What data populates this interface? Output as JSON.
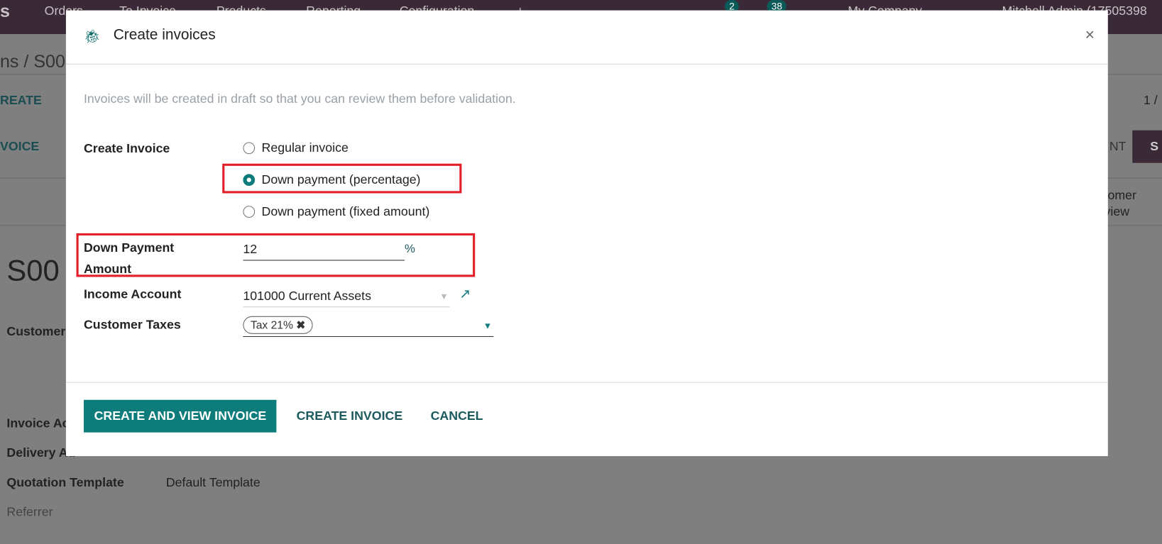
{
  "topbar": {
    "app": "s",
    "menu": [
      "Orders",
      "To Invoice",
      "Products",
      "Reporting",
      "Configuration"
    ],
    "plus": "+",
    "messages_count": "2",
    "activities_count": "38",
    "company": "My Company",
    "user": "Mitchell Admin (17505398"
  },
  "background": {
    "breadcrumb": "ns / S00",
    "create": "REATE",
    "pager": "1 /",
    "invoice_tab": "VOICE",
    "status_left": "NT",
    "status_right": "S",
    "customer_preview": [
      "tomer",
      "view"
    ],
    "record": "S00",
    "fields": [
      "Customer",
      "Invoice Ac",
      "Delivery Ad",
      "Quotation Template",
      "Referrer"
    ],
    "quotation_template_value": "Default Template"
  },
  "modal": {
    "title": "Create invoices",
    "icon": "bug-icon",
    "close": "×",
    "hint": "Invoices will be created in draft so that you can review them before validation.",
    "create_invoice_label": "Create Invoice",
    "options": [
      {
        "label": "Regular invoice",
        "selected": false
      },
      {
        "label": "Down payment (percentage)",
        "selected": true
      },
      {
        "label": "Down payment (fixed amount)",
        "selected": false
      }
    ],
    "down_payment_label": "Down Payment Amount",
    "down_payment_value": "12",
    "down_payment_unit": "%",
    "income_account_label": "Income Account",
    "income_account_value": "101000 Current Assets",
    "customer_taxes_label": "Customer Taxes",
    "tax_tag": "Tax 21%",
    "buttons": {
      "create_view": "CREATE AND VIEW INVOICE",
      "create": "CREATE INVOICE",
      "cancel": "CANCEL"
    }
  },
  "colors": {
    "primary": "#0e7c7b",
    "highlight": "#e3202a",
    "navbar": "#3a2a37"
  }
}
